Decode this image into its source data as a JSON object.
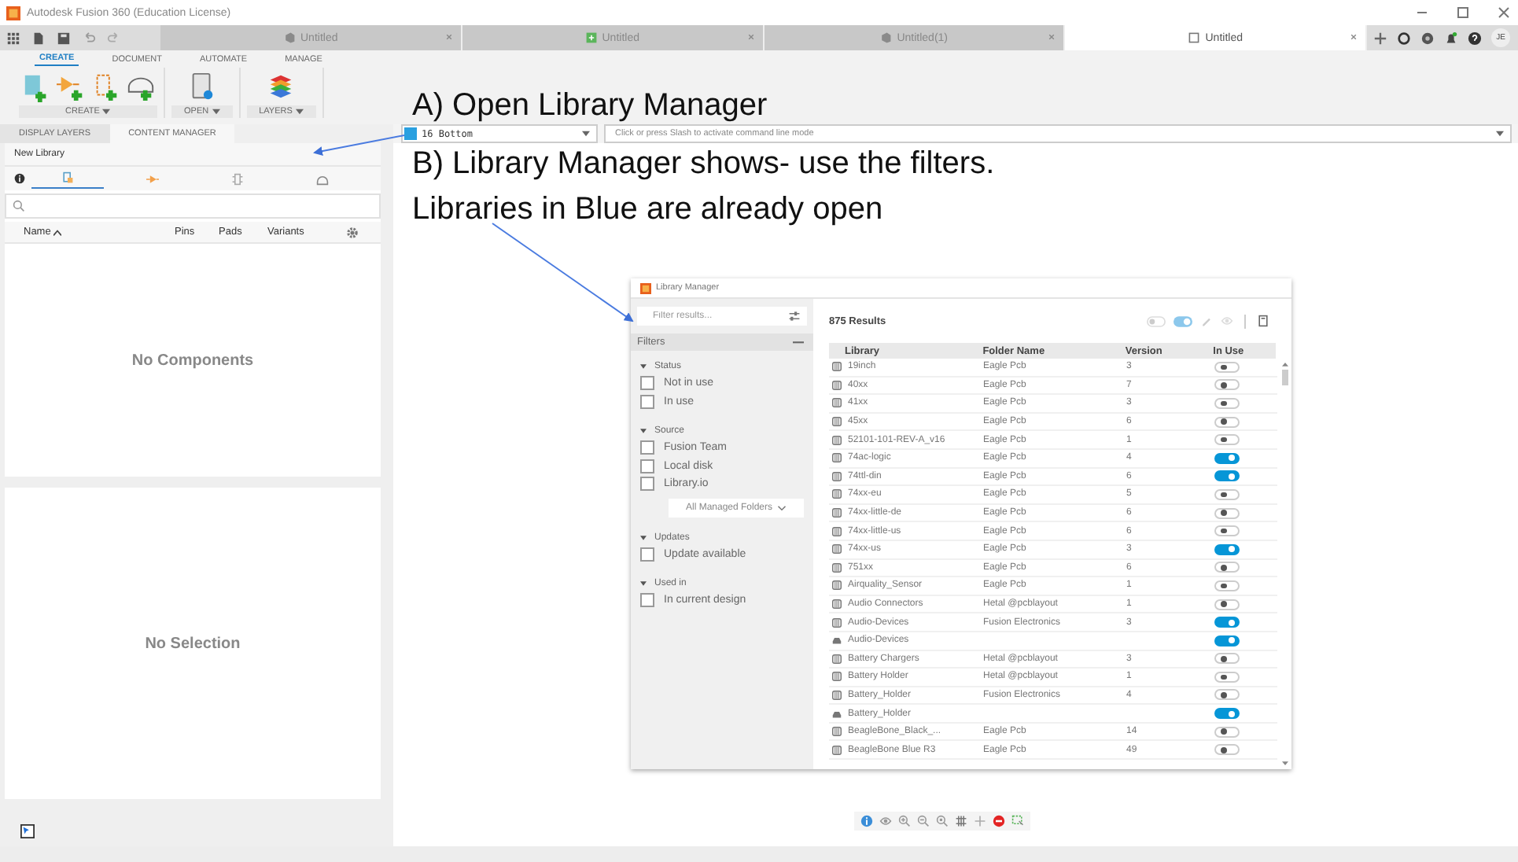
{
  "window": {
    "title": "Autodesk Fusion 360 (Education License)"
  },
  "doc_tabs": [
    {
      "label": "Untitled",
      "selected": false,
      "kind": "design"
    },
    {
      "label": "Untitled",
      "selected": false,
      "kind": "schematic"
    },
    {
      "label": "Untitled(1)",
      "selected": false,
      "kind": "design"
    },
    {
      "label": "Untitled",
      "selected": true,
      "kind": "library"
    }
  ],
  "user": {
    "initials": "JE"
  },
  "ribbon": {
    "tabs": [
      {
        "label": "CREATE",
        "selected": true
      },
      {
        "label": "DOCUMENT",
        "selected": false
      },
      {
        "label": "AUTOMATE",
        "selected": false
      },
      {
        "label": "MANAGE",
        "selected": false
      }
    ],
    "groups": [
      {
        "label": "CREATE",
        "kind": "create"
      },
      {
        "label": "OPEN",
        "kind": "open"
      },
      {
        "label": "LAYERS",
        "kind": "layers"
      }
    ]
  },
  "panel_tabs": [
    {
      "label": "DISPLAY LAYERS",
      "selected": false
    },
    {
      "label": "CONTENT MANAGER",
      "selected": true
    }
  ],
  "library_name": "New Library",
  "content_tabs": [
    {
      "kind": "device",
      "selected": true
    },
    {
      "kind": "symbol",
      "selected": false
    },
    {
      "kind": "footprint",
      "selected": false
    },
    {
      "kind": "package",
      "selected": false
    }
  ],
  "components_table": {
    "columns": [
      {
        "label": "Name",
        "sorted": true
      },
      {
        "label": "Pins",
        "sorted": false
      },
      {
        "label": "Pads",
        "sorted": false
      },
      {
        "label": "Variants",
        "sorted": false
      }
    ],
    "empty_text": "No Components"
  },
  "selection_panel": {
    "empty_text": "No Selection"
  },
  "layer_select": {
    "value": "16 Bottom"
  },
  "command_line": {
    "placeholder": "Click or press Slash to activate command line mode"
  },
  "annotations": [
    "A) Open Library Manager",
    "B) Library Manager shows- use the filters.",
    "Libraries in Blue are already open"
  ],
  "library_manager": {
    "title": "Library Manager",
    "filter_placeholder": "Filter results...",
    "filters_label": "Filters",
    "filter_groups": [
      {
        "label": "Status",
        "expanded": true,
        "options": [
          {
            "label": "Not in use",
            "checked": false
          },
          {
            "label": "In use",
            "checked": false
          }
        ]
      },
      {
        "label": "Source",
        "expanded": true,
        "options": [
          {
            "label": "Fusion Team",
            "checked": false
          },
          {
            "label": "Local disk",
            "checked": false
          },
          {
            "label": "Library.io",
            "checked": false
          }
        ],
        "dropdown": "All Managed Folders"
      },
      {
        "label": "Updates",
        "expanded": true,
        "options": [
          {
            "label": "Update available",
            "checked": false
          }
        ]
      },
      {
        "label": "Used in",
        "expanded": true,
        "options": [
          {
            "label": "In current design",
            "checked": false
          }
        ]
      }
    ],
    "results": "875 Results",
    "columns": [
      "Library",
      "Folder Name",
      "Version",
      "In Use"
    ],
    "rows": [
      {
        "kind": "grid",
        "library": "19inch",
        "folder": "Eagle Pcb",
        "version": "3",
        "in_use": false
      },
      {
        "kind": "grid",
        "library": "40xx",
        "folder": "Eagle Pcb",
        "version": "7",
        "in_use": false
      },
      {
        "kind": "grid",
        "library": "41xx",
        "folder": "Eagle Pcb",
        "version": "3",
        "in_use": false
      },
      {
        "kind": "grid",
        "library": "45xx",
        "folder": "Eagle Pcb",
        "version": "6",
        "in_use": false
      },
      {
        "kind": "grid",
        "library": "52101-101-REV-A_v16",
        "folder": "Eagle Pcb",
        "version": "1",
        "in_use": false
      },
      {
        "kind": "grid",
        "library": "74ac-logic",
        "folder": "Eagle Pcb",
        "version": "4",
        "in_use": true
      },
      {
        "kind": "grid",
        "library": "74ttl-din",
        "folder": "Eagle Pcb",
        "version": "6",
        "in_use": true
      },
      {
        "kind": "grid",
        "library": "74xx-eu",
        "folder": "Eagle Pcb",
        "version": "5",
        "in_use": false
      },
      {
        "kind": "grid",
        "library": "74xx-little-de",
        "folder": "Eagle Pcb",
        "version": "6",
        "in_use": false
      },
      {
        "kind": "grid",
        "library": "74xx-little-us",
        "folder": "Eagle Pcb",
        "version": "6",
        "in_use": false
      },
      {
        "kind": "grid",
        "library": "74xx-us",
        "folder": "Eagle Pcb",
        "version": "3",
        "in_use": true
      },
      {
        "kind": "grid",
        "library": "751xx",
        "folder": "Eagle Pcb",
        "version": "6",
        "in_use": false
      },
      {
        "kind": "grid",
        "library": "Airquality_Sensor",
        "folder": "Eagle Pcb",
        "version": "1",
        "in_use": false
      },
      {
        "kind": "grid",
        "library": "Audio Connectors",
        "folder": "Hetal @pcblayout",
        "version": "1",
        "in_use": false
      },
      {
        "kind": "grid",
        "library": "Audio-Devices",
        "folder": "Fusion Electronics",
        "version": "3",
        "in_use": true
      },
      {
        "kind": "drive",
        "library": "Audio-Devices",
        "in_use": true
      },
      {
        "kind": "grid",
        "library": "Battery Chargers",
        "folder": "Hetal @pcblayout",
        "version": "3",
        "in_use": false
      },
      {
        "kind": "grid",
        "library": "Battery Holder",
        "folder": "Hetal @pcblayout",
        "version": "1",
        "in_use": false
      },
      {
        "kind": "grid",
        "library": "Battery_Holder",
        "folder": "Fusion Electronics",
        "version": "4",
        "in_use": false
      },
      {
        "kind": "drive",
        "library": "Battery_Holder",
        "in_use": true
      },
      {
        "kind": "grid",
        "library": "BeagleBone_Black_...",
        "folder": "Eagle Pcb",
        "version": "14",
        "in_use": false
      },
      {
        "kind": "grid",
        "library": "BeagleBone Blue R3",
        "folder": "Eagle Pcb",
        "version": "49",
        "in_use": false
      }
    ]
  }
}
